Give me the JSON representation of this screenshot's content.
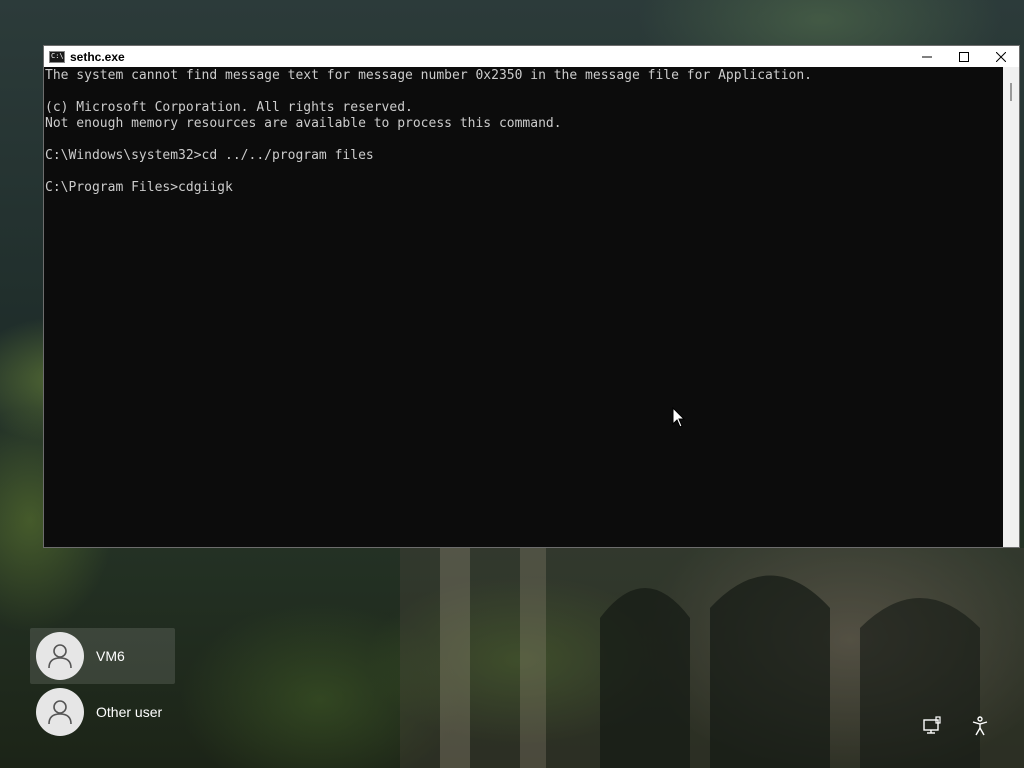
{
  "window": {
    "title": "sethc.exe",
    "icon_label": "C:\\",
    "controls": [
      "minimize-icon",
      "maximize-icon",
      "close-icon"
    ]
  },
  "console": {
    "lines": [
      "The system cannot find message text for message number 0x2350 in the message file for Application.",
      "",
      "(c) Microsoft Corporation. All rights reserved.",
      "Not enough memory resources are available to process this command.",
      "",
      "C:\\Windows\\system32>cd ../../program files",
      "",
      "C:\\Program Files>cdgiigk"
    ],
    "text_color": "#cccccc",
    "background_color": "#0c0c0c"
  },
  "users": [
    {
      "name": "VM6",
      "selected": true
    },
    {
      "name": "Other user",
      "selected": false
    }
  ],
  "tray": {
    "icons": [
      "network-icon",
      "accessibility-icon"
    ]
  }
}
